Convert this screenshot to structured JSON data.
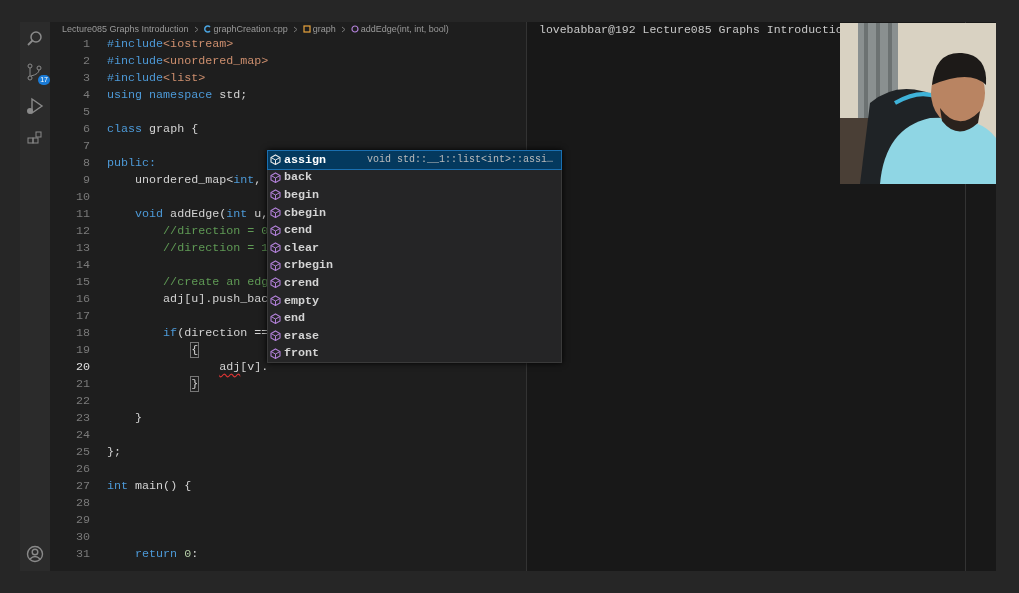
{
  "breadcrumb": [
    {
      "kind": "folder",
      "text": "Lecture085 Graphs Introduction"
    },
    {
      "kind": "file",
      "text": "graphCreation.cpp"
    },
    {
      "kind": "class",
      "text": "graph"
    },
    {
      "kind": "method",
      "text": "addEdge(int, int, bool)"
    }
  ],
  "source_control_badge": "17",
  "editor": {
    "lines": [
      {
        "number": "1",
        "current": false,
        "tokens": [
          {
            "kind": "keyword",
            "text": "#include"
          },
          {
            "kind": "string",
            "text": "<iostream>"
          }
        ]
      },
      {
        "number": "2",
        "current": false,
        "tokens": [
          {
            "kind": "keyword",
            "text": "#include"
          },
          {
            "kind": "string",
            "text": "<unordered_map>"
          }
        ]
      },
      {
        "number": "3",
        "current": false,
        "tokens": [
          {
            "kind": "keyword",
            "text": "#include"
          },
          {
            "kind": "string",
            "text": "<list>"
          }
        ]
      },
      {
        "number": "4",
        "current": false,
        "tokens": [
          {
            "kind": "keyword",
            "text": "using namespace"
          },
          {
            "kind": "plain",
            "text": " std;"
          }
        ]
      },
      {
        "number": "5",
        "current": false
      },
      {
        "number": "6",
        "current": false,
        "tokens": [
          {
            "kind": "keyword",
            "text": "class"
          },
          {
            "kind": "plain",
            "text": " graph {"
          }
        ]
      },
      {
        "number": "7",
        "current": false
      },
      {
        "number": "8",
        "current": false,
        "tokens": [
          {
            "kind": "keyword",
            "text": "public:"
          }
        ]
      },
      {
        "number": "9",
        "current": false,
        "tokens": [
          {
            "kind": "plain",
            "text": "    unordered_map<"
          },
          {
            "kind": "keyword",
            "text": "int"
          },
          {
            "kind": "plain",
            "text": ","
          }
        ]
      },
      {
        "number": "10",
        "current": false
      },
      {
        "number": "11",
        "current": false,
        "tokens": [
          {
            "kind": "keyword",
            "text": "    void"
          },
          {
            "kind": "plain",
            "text": " addEdge("
          },
          {
            "kind": "keyword",
            "text": "int"
          },
          {
            "kind": "plain",
            "text": " u,"
          }
        ]
      },
      {
        "number": "12",
        "current": false,
        "tokens": [
          {
            "kind": "comment",
            "text": "        //direction = 0"
          }
        ]
      },
      {
        "number": "13",
        "current": false,
        "tokens": [
          {
            "kind": "comment",
            "text": "        //direction = 1"
          }
        ]
      },
      {
        "number": "14",
        "current": false
      },
      {
        "number": "15",
        "current": false,
        "tokens": [
          {
            "kind": "comment",
            "text": "        //create an edg"
          }
        ]
      },
      {
        "number": "16",
        "current": false,
        "tokens": [
          {
            "kind": "plain",
            "text": "        adj[u].push_bac"
          }
        ]
      },
      {
        "number": "17",
        "current": false
      },
      {
        "number": "18",
        "current": false,
        "tokens": [
          {
            "kind": "keyword",
            "text": "        if"
          },
          {
            "kind": "plain",
            "text": "(direction =="
          }
        ]
      },
      {
        "number": "19",
        "current": false,
        "tokens": [
          {
            "kind": "match",
            "text": "            {"
          }
        ]
      },
      {
        "number": "20",
        "current": true,
        "tokens": [
          {
            "kind": "error",
            "text": "                adj"
          },
          {
            "kind": "plain",
            "text": "[v]."
          }
        ]
      },
      {
        "number": "21",
        "current": false,
        "tokens": [
          {
            "kind": "match",
            "text": "            }"
          }
        ]
      },
      {
        "number": "22",
        "current": false
      },
      {
        "number": "23",
        "current": false,
        "tokens": [
          {
            "kind": "plain",
            "text": "    }"
          }
        ]
      },
      {
        "number": "24",
        "current": false
      },
      {
        "number": "25",
        "current": false,
        "tokens": [
          {
            "kind": "plain",
            "text": "};"
          }
        ]
      },
      {
        "number": "26",
        "current": false
      },
      {
        "number": "27",
        "current": false,
        "tokens": [
          {
            "kind": "keyword",
            "text": "int"
          },
          {
            "kind": "plain",
            "text": " main() {"
          }
        ]
      },
      {
        "number": "28",
        "current": false
      },
      {
        "number": "29",
        "current": false
      },
      {
        "number": "30",
        "current": false
      },
      {
        "number": "31",
        "current": false,
        "tokens": [
          {
            "kind": "keyword",
            "text": "    return "
          },
          {
            "kind": "number",
            "text": "0"
          },
          {
            "kind": "plain",
            "text": ":"
          }
        ]
      }
    ]
  },
  "suggestions": [
    {
      "label": "assign",
      "selected": true,
      "detail": "void std::__1::list<int>::assi…"
    },
    {
      "label": "back",
      "selected": false
    },
    {
      "label": "begin",
      "selected": false
    },
    {
      "label": "cbegin",
      "selected": false
    },
    {
      "label": "cend",
      "selected": false
    },
    {
      "label": "clear",
      "selected": false
    },
    {
      "label": "crbegin",
      "selected": false
    },
    {
      "label": "crend",
      "selected": false
    },
    {
      "label": "empty",
      "selected": false
    },
    {
      "label": "end",
      "selected": false
    },
    {
      "label": "erase",
      "selected": false
    },
    {
      "label": "front",
      "selected": false
    }
  ],
  "terminal": {
    "prompt": "lovebabbar@192 Lecture085 Graphs Introductio"
  }
}
